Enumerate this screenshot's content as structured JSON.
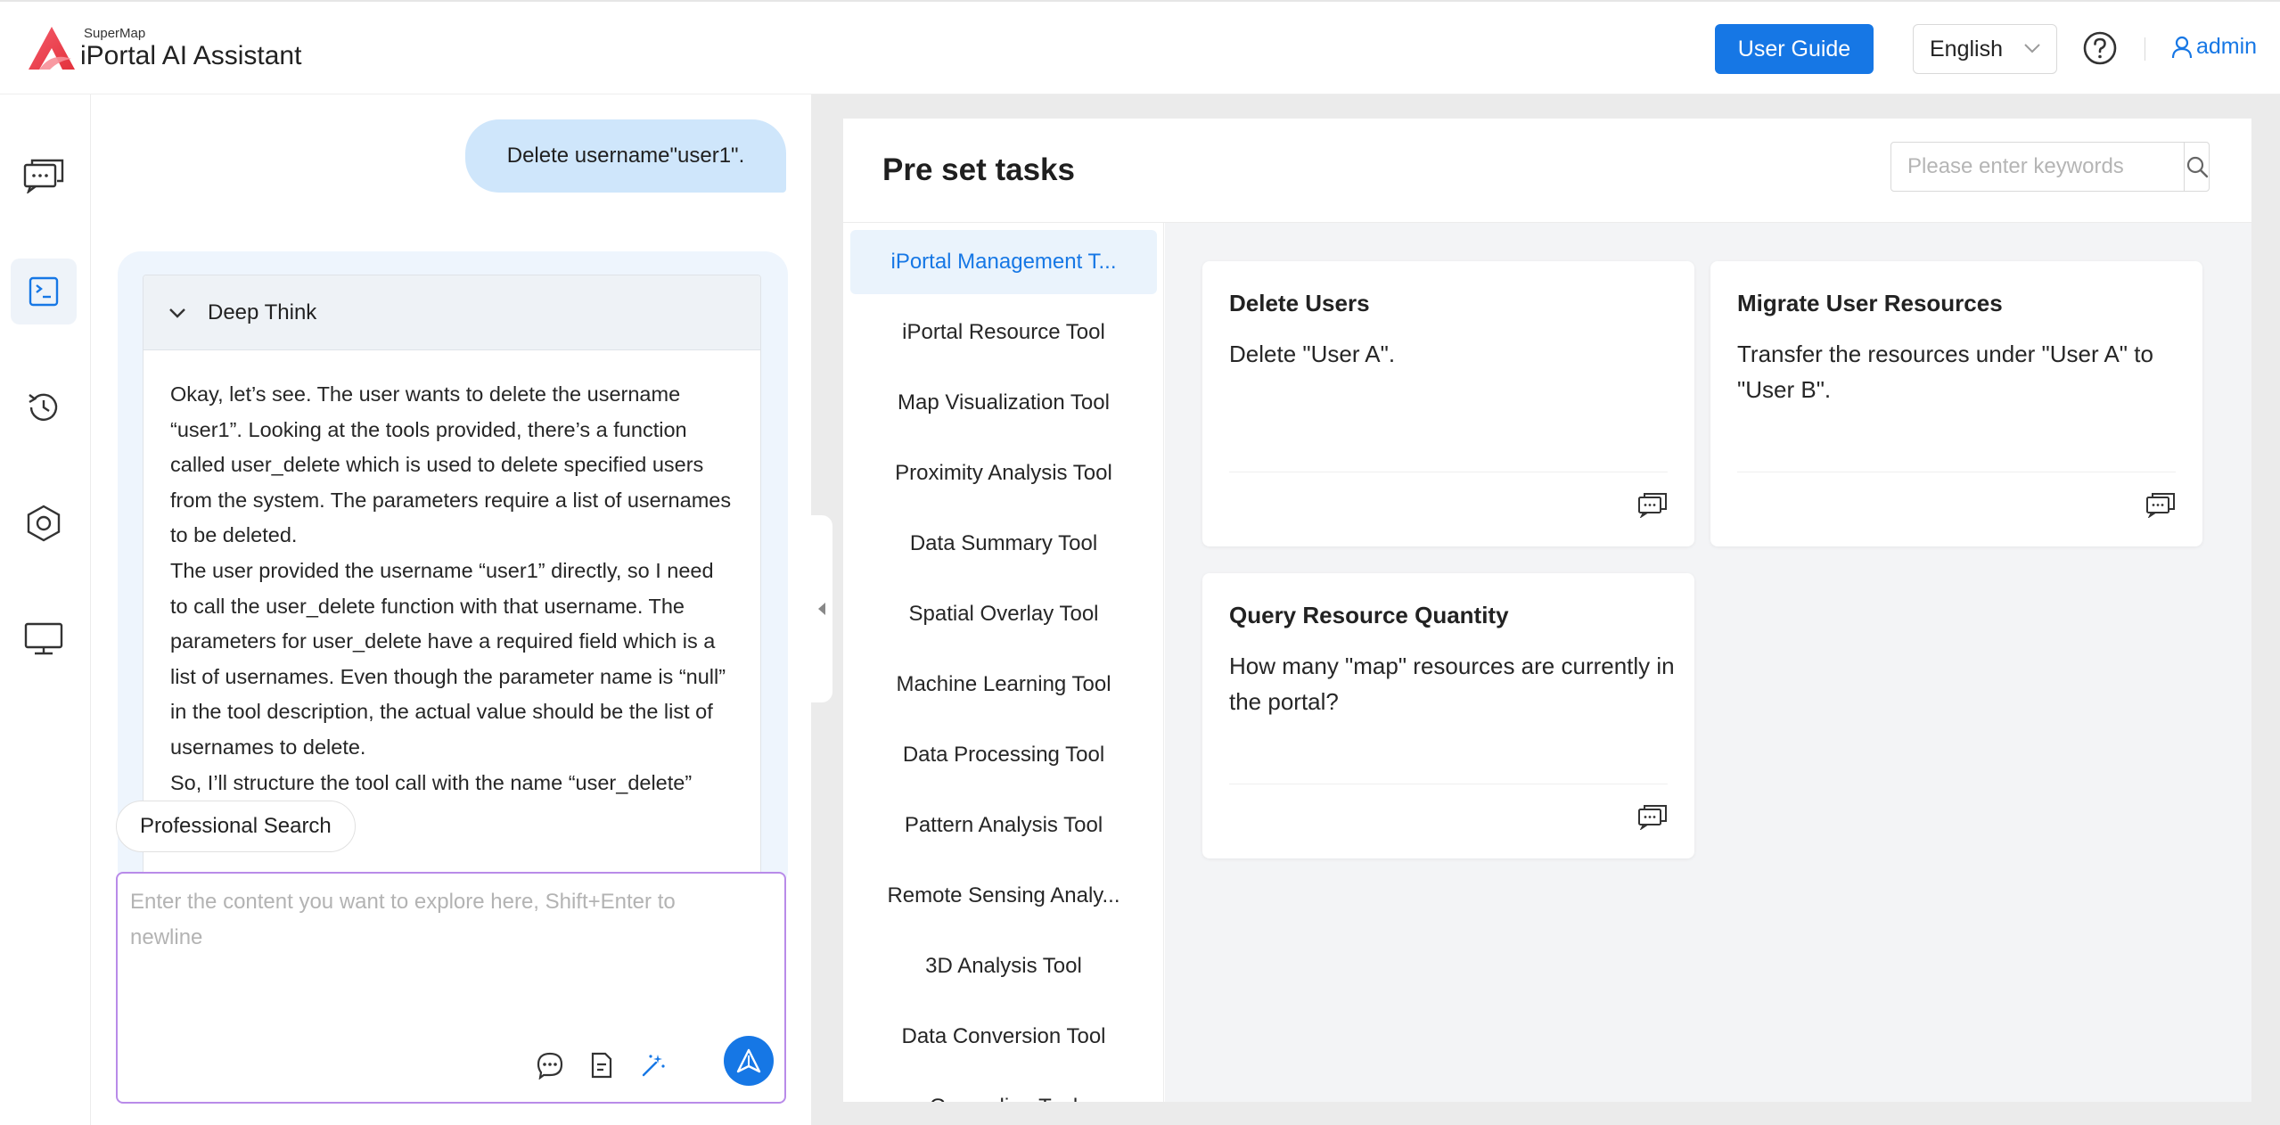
{
  "header": {
    "brand_small": "SuperMap",
    "brand_title": "iPortal AI Assistant",
    "user_guide_label": "User Guide",
    "language": "English",
    "username": "admin"
  },
  "rail": {
    "icons": [
      "chat-icon",
      "terminal-icon",
      "history-icon",
      "settings-icon",
      "monitor-icon"
    ],
    "active_index": 1
  },
  "chat": {
    "user_message": "Delete username\"user1\".",
    "deep_think_label": "Deep Think",
    "thinking": [
      "Okay, let’s see. The user wants to delete the username “user1”. Looking at the tools provided, there’s a function called user_delete which is used to delete specified users from the system. The parameters require a list of usernames to be deleted.",
      "The user provided the username “user1” directly, so I need to call the user_delete function with that username. The parameters for user_delete have a required field which is a list of usernames. Even though the parameter name is “null” in the tool description, the actual value should be the list of usernames to delete.",
      "So, I’ll structure the tool call with the name “user_delete”"
    ],
    "professional_search_label": "Professional Search",
    "input_placeholder": "Enter the content you want to explore here, Shift+Enter to newline"
  },
  "panel": {
    "title": "Pre set tasks",
    "search_placeholder": "Please enter keywords",
    "categories": [
      "iPortal Management T...",
      "iPortal Resource Tool",
      "Map Visualization Tool",
      "Proximity Analysis Tool",
      "Data Summary Tool",
      "Spatial Overlay Tool",
      "Machine Learning Tool",
      "Data Processing Tool",
      "Pattern Analysis Tool",
      "Remote Sensing Analy...",
      "3D Analysis Tool",
      "Data Conversion Tool",
      "Geocoding Tool"
    ],
    "active_category": 0,
    "tasks": [
      {
        "title": "Delete Users",
        "description": "Delete \"User A\"."
      },
      {
        "title": "Migrate User Resources",
        "description": "Transfer the resources under \"User A\" to \"User B\"."
      },
      {
        "title": "Query Resource Quantity",
        "description": "How many \"map\" resources are currently in the portal?"
      }
    ]
  },
  "colors": {
    "accent": "#1677e5",
    "user_bubble": "#cfe6fb",
    "input_border": "#b98be9"
  }
}
